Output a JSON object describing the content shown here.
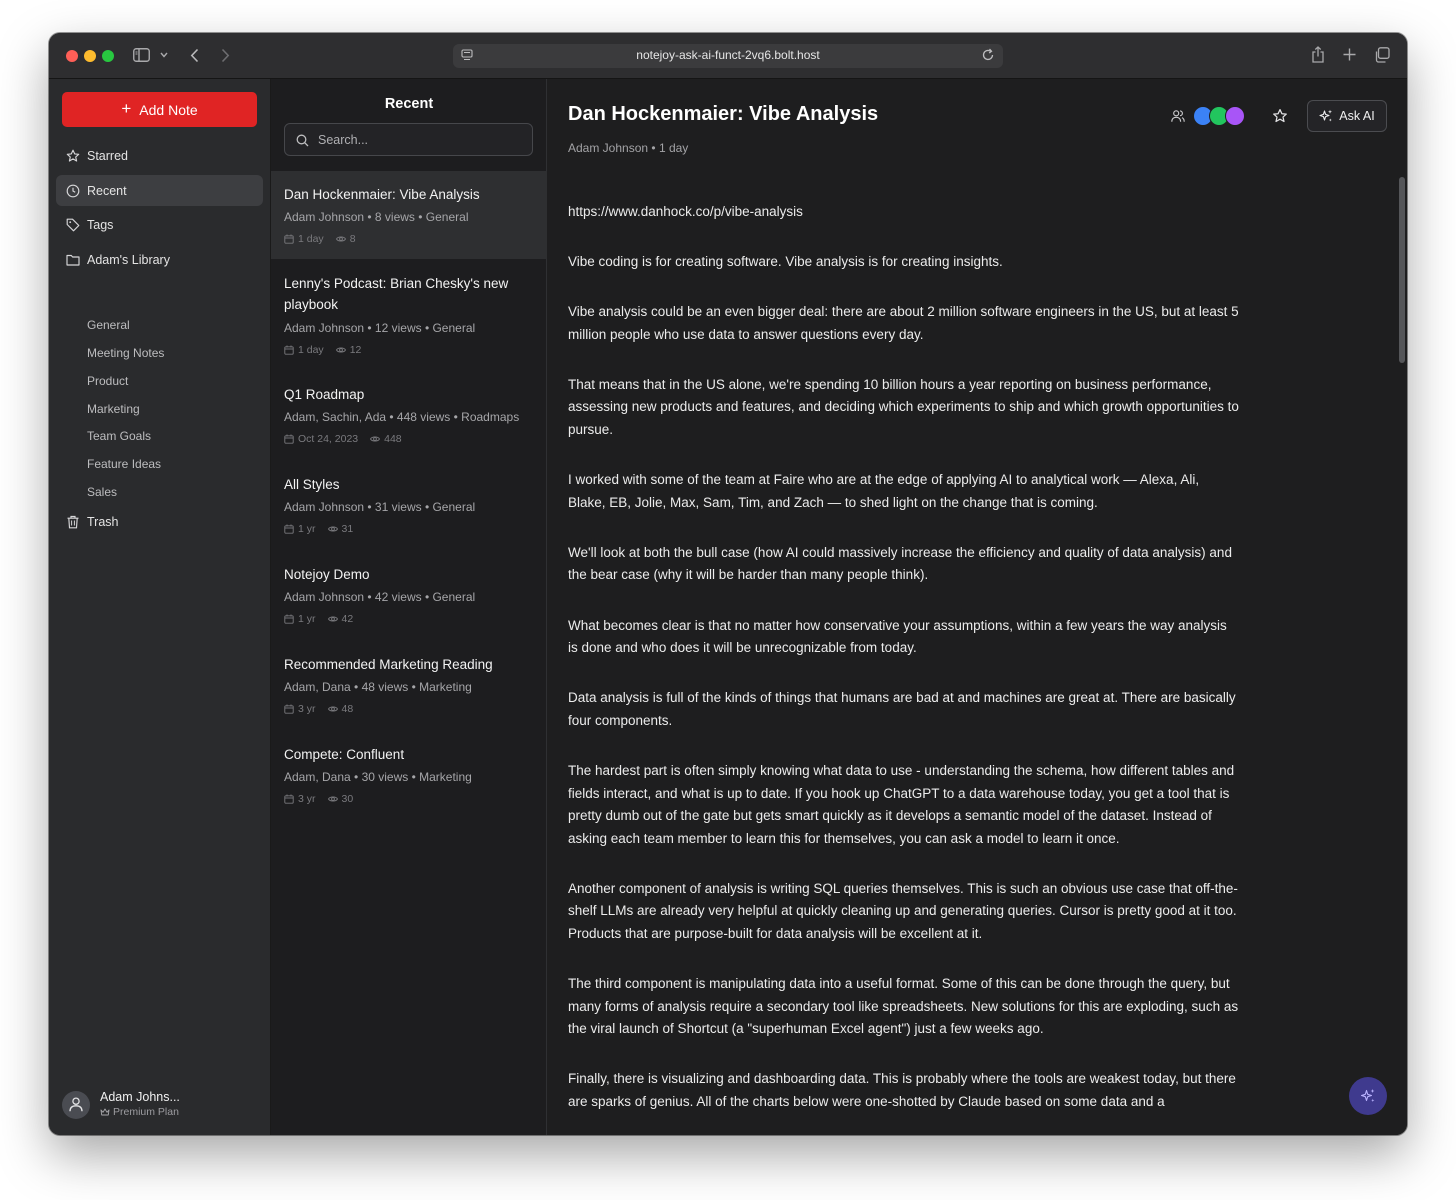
{
  "browser": {
    "url": "notejoy-ask-ai-funct-2vq6.bolt.host"
  },
  "sidebar": {
    "add_note_label": "Add Note",
    "items": [
      {
        "label": "Starred"
      },
      {
        "label": "Recent"
      },
      {
        "label": "Tags"
      },
      {
        "label": "Adam's Library"
      }
    ],
    "library_items": [
      {
        "label": "General"
      },
      {
        "label": "Meeting Notes"
      },
      {
        "label": "Product"
      },
      {
        "label": "Marketing"
      },
      {
        "label": "Team Goals"
      },
      {
        "label": "Feature Ideas"
      },
      {
        "label": "Sales"
      }
    ],
    "trash_label": "Trash",
    "user": {
      "name": "Adam Johns...",
      "plan": "Premium Plan"
    }
  },
  "list": {
    "title": "Recent",
    "search_placeholder": "Search...",
    "notes": [
      {
        "title": "Dan Hockenmaier: Vibe Analysis",
        "meta": "Adam Johnson • 8 views • General",
        "date": "1 day",
        "views": "8"
      },
      {
        "title": "Lenny's Podcast: Brian Chesky's new playbook",
        "meta": "Adam Johnson • 12 views • General",
        "date": "1 day",
        "views": "12"
      },
      {
        "title": "Q1 Roadmap",
        "meta": "Adam, Sachin, Ada • 448 views • Roadmaps",
        "date": "Oct 24, 2023",
        "views": "448"
      },
      {
        "title": "All Styles",
        "meta": "Adam Johnson • 31 views • General",
        "date": "1 yr",
        "views": "31"
      },
      {
        "title": "Notejoy Demo",
        "meta": "Adam Johnson • 42 views • General",
        "date": "1 yr",
        "views": "42"
      },
      {
        "title": "Recommended Marketing Reading",
        "meta": "Adam, Dana • 48 views • Marketing",
        "date": "3 yr",
        "views": "48"
      },
      {
        "title": "Compete: Confluent",
        "meta": "Adam, Dana • 30 views • Marketing",
        "date": "3 yr",
        "views": "30"
      }
    ]
  },
  "document": {
    "title": "Dan Hockenmaier: Vibe Analysis",
    "author": "Adam Johnson",
    "age": "1 day",
    "ask_ai_label": "Ask AI",
    "collaborator_colors": [
      "#3b82f6",
      "#22c55e",
      "#a855f7"
    ],
    "paragraphs": [
      "https://www.danhock.co/p/vibe-analysis",
      "Vibe coding is for creating software. Vibe analysis is for creating insights.",
      "Vibe analysis could be an even bigger deal: there are about 2 million software engineers in the US, but at least 5 million people who use data to answer questions every day.",
      "That means that in the US alone, we're spending 10 billion hours a year reporting on business performance, assessing new products and features, and deciding which experiments to ship and which growth opportunities to pursue.",
      "I worked with some of the team at Faire who are at the edge of applying AI to analytical work — Alexa, Ali, Blake, EB, Jolie, Max, Sam, Tim, and Zach — to shed light on the change that is coming.",
      "We'll look at both the bull case (how AI could massively increase the efficiency and quality of data analysis) and the bear case (why it will be harder than many people think).",
      "What becomes clear is that no matter how conservative your assumptions, within a few years the way analysis is done and who does it will be unrecognizable from today.",
      "Data analysis is full of the kinds of things that humans are bad at and machines are great at. There are basically four components.",
      "The hardest part is often simply knowing what data to use - understanding the schema, how different tables and fields interact, and what is up to date. If you hook up ChatGPT to a data warehouse today, you get a tool that is pretty dumb out of the gate but gets smart quickly as it develops a semantic model of the dataset. Instead of asking each team member to learn this for themselves, you can ask a model to learn it once.",
      "Another component of analysis is writing SQL queries themselves. This is such an obvious use case that off-the-shelf LLMs are already very helpful at quickly cleaning up and generating queries. Cursor is pretty good at it too. Products that are purpose-built for data analysis will be excellent at it.",
      "The third component is manipulating data into a useful format. Some of this can be done through the query, but many forms of analysis require a secondary tool like spreadsheets. New solutions for this are exploding, such as the viral launch of Shortcut (a \"superhuman Excel agent\") just a few weeks ago.",
      "Finally, there is visualizing and dashboarding data. This is probably where the tools are weakest today, but there are sparks of genius. All of the charts below were one-shotted by Claude based on some data and a"
    ]
  }
}
